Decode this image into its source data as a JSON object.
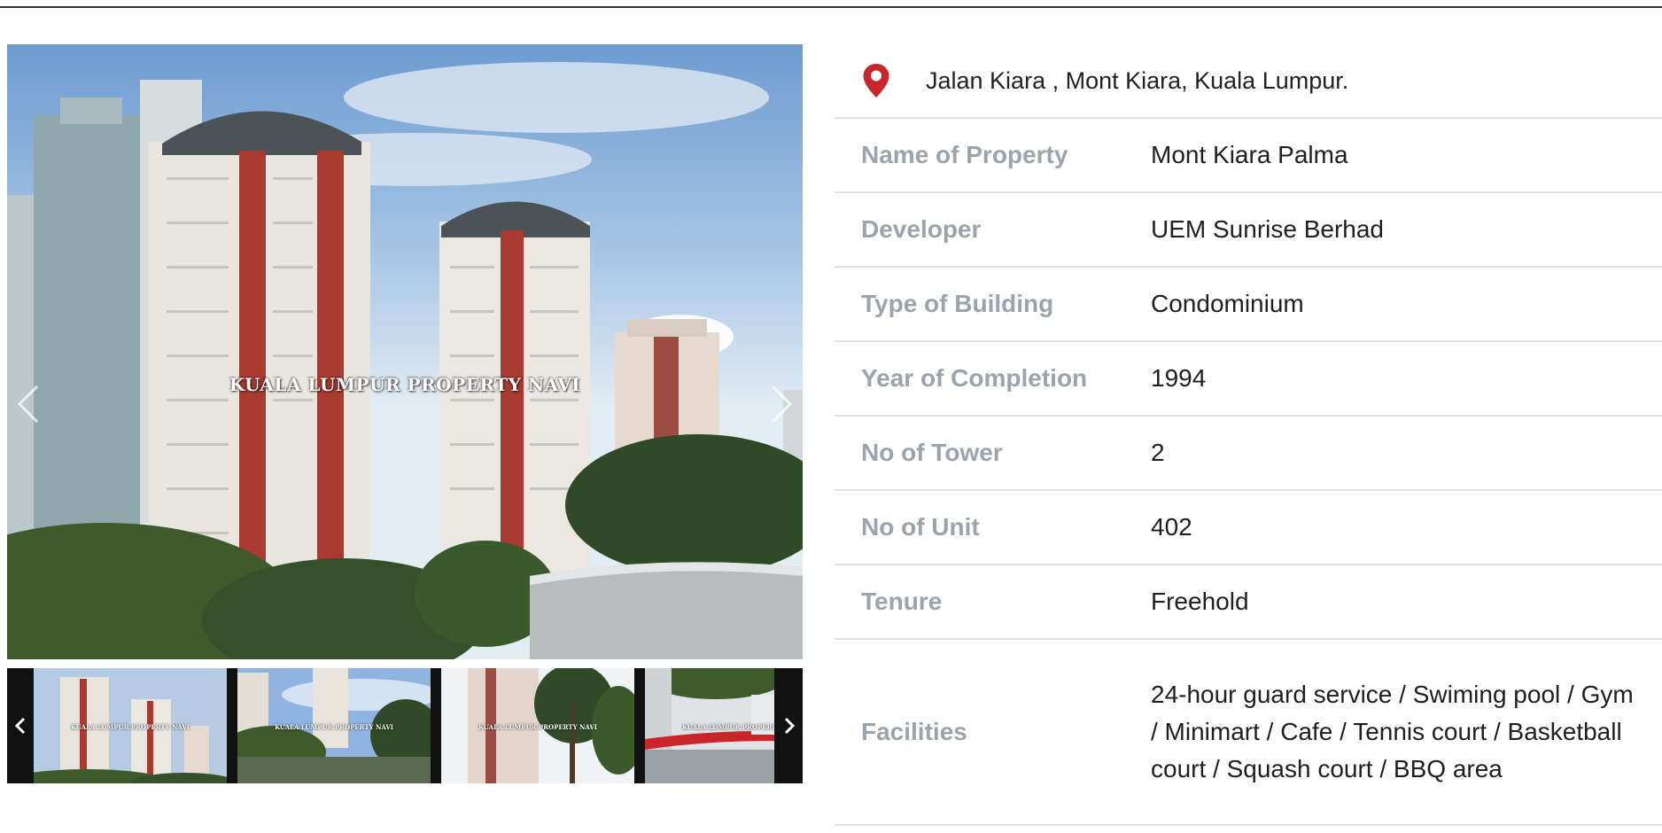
{
  "gallery": {
    "watermark": "KUALA LUMPUR PROPERTY NAVI",
    "prev_icon": "chevron-left-icon",
    "next_icon": "chevron-right-icon",
    "thumb_watermark": "KUALA LUMPUR PROPERTY NAVI",
    "thumbnail_count": 4
  },
  "location": {
    "icon": "map-pin-icon",
    "pin_color": "#c8262a",
    "address": "Jalan Kiara , Mont Kiara, Kuala Lumpur."
  },
  "details": [
    {
      "label": "Name of Property",
      "value": "Mont Kiara Palma"
    },
    {
      "label": "Developer",
      "value": "UEM Sunrise Berhad"
    },
    {
      "label": "Type of Building",
      "value": "Condominium"
    },
    {
      "label": "Year of Completion",
      "value": "1994"
    },
    {
      "label": "No of Tower",
      "value": "2"
    },
    {
      "label": "No of Unit",
      "value": "402"
    },
    {
      "label": "Tenure",
      "value": "Freehold"
    },
    {
      "label": "Facilities",
      "value": "24-hour guard service / Swiming pool / Gym / Minimart / Cafe / Tennis court / Basketball court / Squash court / BBQ area"
    }
  ],
  "colors": {
    "label": "#9aa4ad",
    "value": "#1f1f1f",
    "divider": "#e3e3e3",
    "tower_red": "#a93a30"
  }
}
